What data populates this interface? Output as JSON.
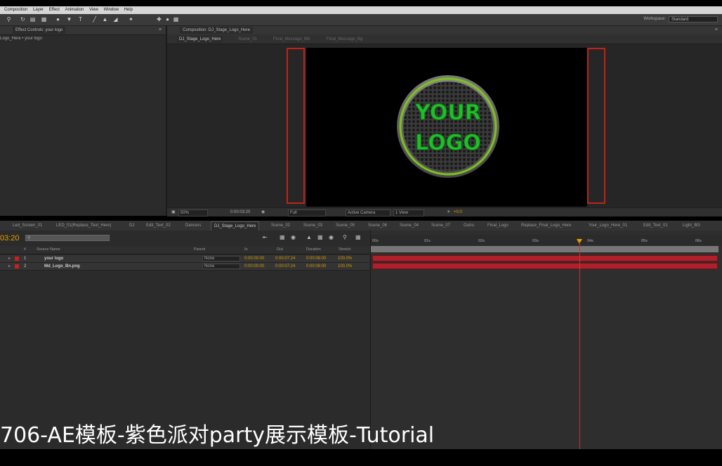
{
  "menu": [
    "Composition",
    "Layer",
    "Effect",
    "Animation",
    "View",
    "Window",
    "Help"
  ],
  "toolbar": {
    "workspace_label": "Workspace:",
    "workspace_value": "Standard"
  },
  "effect_panel": {
    "tab": "Effect Controls: your logo",
    "breadcrumb": "Logo_Here • your logo"
  },
  "comp_panel": {
    "tab": "Composition: DJ_Stage_Logo_Here",
    "subtabs": [
      "DJ_Stage_Logo_Here",
      "Scene_01",
      "Final_Message_Blk",
      "Final_Message_Bg"
    ],
    "logo_line1": "YOUR",
    "logo_line2": "LOGO",
    "bottom": {
      "zoom": "50%",
      "timecode": "0:00:03:20",
      "resolution": "Full",
      "camera": "Active Camera",
      "view": "1 View",
      "exposure": "+0.0"
    }
  },
  "timeline": {
    "tabs": [
      "Led_Screen_01",
      "LED_01(Replace_Text_Here)",
      "DJ",
      "Edit_Text_02",
      "Dancers",
      "DJ_Stage_Logo_Here",
      "Scene_02",
      "Scene_03",
      "Scene_05",
      "Scene_06",
      "Scene_04",
      "Scene_07",
      "Outro",
      "Final_Logo",
      "Replace_Final_Logo_Here",
      "Your_Logo_Here_01",
      "Edit_Text_01",
      "Light_BG"
    ],
    "active_tab": "DJ_Stage_Logo_Here",
    "timecode": "03:20",
    "headers": {
      "source": "Source Name",
      "parent": "Parent",
      "in": "In",
      "out": "Out",
      "duration": "Duration",
      "stretch": "Stretch",
      "number": "#"
    },
    "layers": [
      {
        "num": "1",
        "name": "your logo",
        "parent": "None",
        "in": "0:00:00:00",
        "out": "0:00:07:24",
        "duration": "0:00:08:00",
        "stretch": "100.0%"
      },
      {
        "num": "2",
        "name": "Md_Logo_Bn.png",
        "parent": "None",
        "in": "0:00:00:00",
        "out": "0:00:07:24",
        "duration": "0:00:08:00",
        "stretch": "100.0%"
      }
    ],
    "ruler": [
      "00s",
      "01s",
      "02s",
      "03s",
      "04s",
      "05s",
      "06s"
    ]
  },
  "subtitle": "706-AE模板-紫色派对party展示模板-Tutorial",
  "colors": {
    "accent": "#c0221b",
    "logo_green": "#1fbf2a",
    "timecode": "#e0a000"
  }
}
